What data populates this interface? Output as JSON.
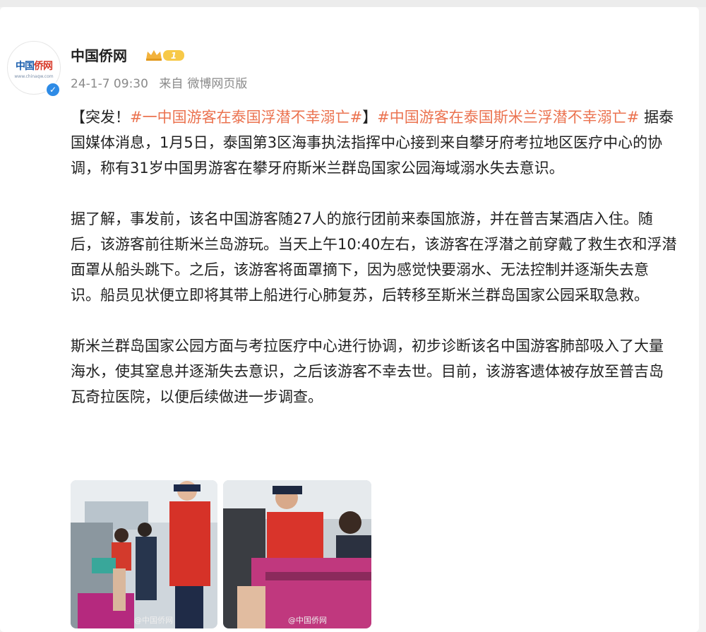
{
  "post": {
    "author_name": "中国侨网",
    "vip_level": "1",
    "timestamp": "24-1-7 09:30",
    "source_label": "来自",
    "source": "微博网页版",
    "avatar_logo": {
      "left": "中国",
      "right": "侨网",
      "sub": "www.chinaqw.com"
    },
    "paragraph1": {
      "prefix": "【突发！",
      "tag1": "#一中国游客在泰国浮潜不幸溺亡#",
      "middle": "】",
      "tag2": "#中国游客在泰国斯米兰浮潜不幸溺亡#",
      "text": " 据泰国媒体消息，1月5日，泰国第3区海事执法指挥中心接到来自攀牙府考拉地区医疗中心的协调，称有31岁中国男游客在攀牙府斯米兰群岛国家公园海域溺水失去意识。"
    },
    "paragraph2": "据了解，事发前，该名中国游客随27人的旅行团前来泰国旅游，并在普吉某酒店入住。随后，该游客前往斯米兰岛游玩。当天上午10:40左右，该游客在浮潜之前穿戴了救生衣和浮潜面罩从船头跳下。之后，该游客将面罩摘下，因为感觉快要溺水、无法控制并逐渐失去意识。船员见状便立即将其带上船进行心肺复苏，后转移至斯米兰群岛国家公园采取急救。",
    "paragraph3": "斯米兰群岛国家公园方面与考拉医疗中心进行协调，初步诊断该名中国游客肺部吸入了大量海水，使其窒息并逐渐失去意识，之后该游客不幸去世。目前，该游客遗体被存放至普吉岛瓦奇拉医院，以便后续做进一步调查。",
    "photo_watermarks": [
      "@中国侨网",
      "@中国侨网"
    ]
  },
  "colors": {
    "tag": "#eb7350",
    "verified": "#2e8be6"
  }
}
